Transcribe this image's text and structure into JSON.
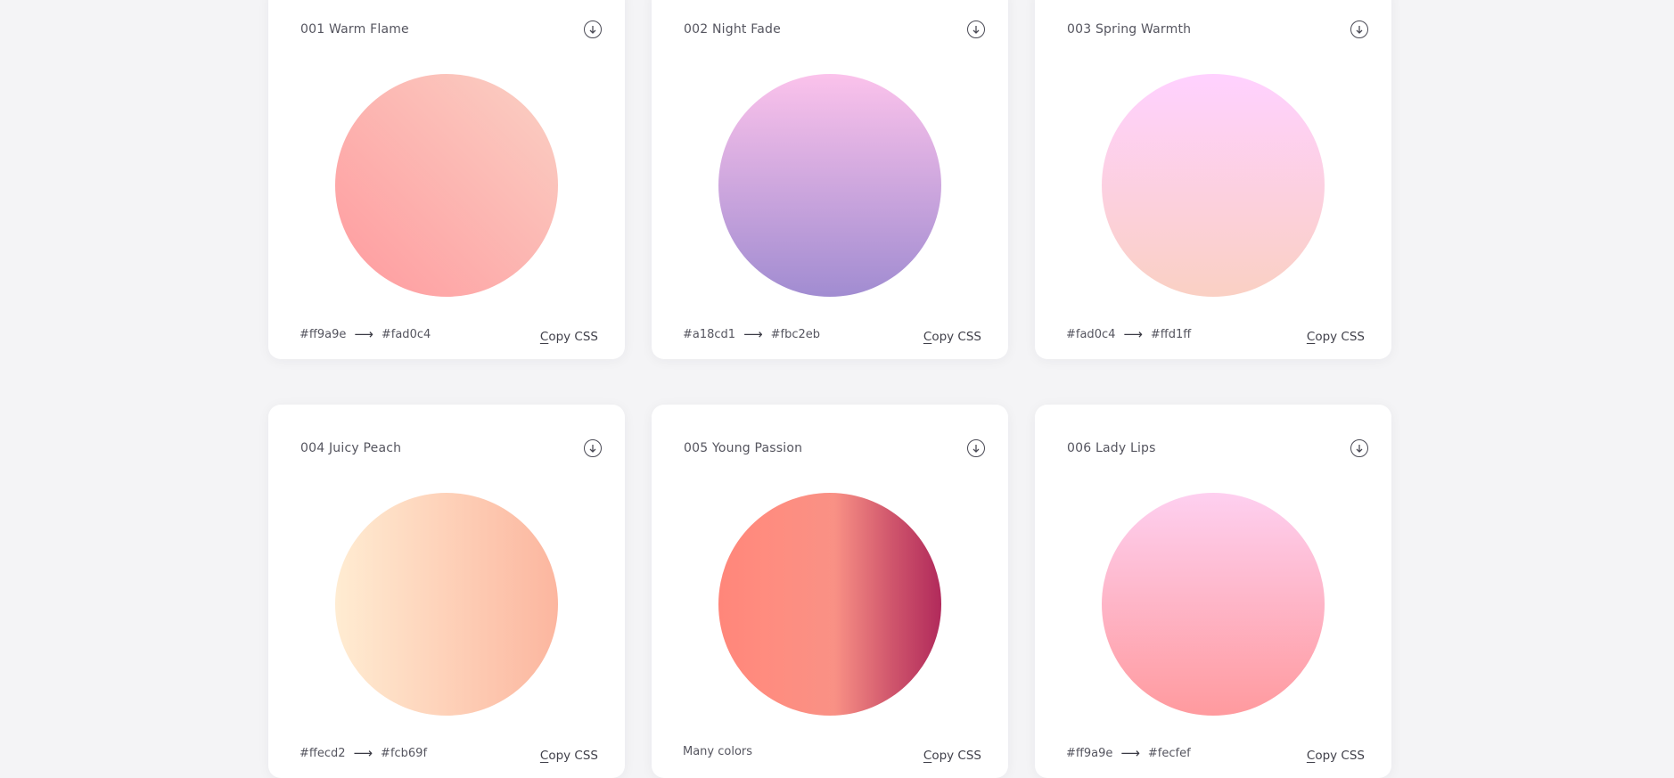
{
  "gradients": [
    {
      "title": "001 Warm Flame",
      "color_from": "#ff9a9e",
      "arrow": "⟶",
      "color_to": "#fad0c4",
      "colors_text": "",
      "copy_label": "Copy CSS",
      "css": "linear-gradient(45deg, #ff9a9e 0%, #fad0c4 99%, #fad0c4 100%)"
    },
    {
      "title": "002 Night Fade",
      "color_from": "#a18cd1",
      "arrow": "⟶",
      "color_to": "#fbc2eb",
      "colors_text": "",
      "copy_label": "Copy CSS",
      "css": "linear-gradient(to top, #a18cd1 0%, #fbc2eb 100%)"
    },
    {
      "title": "003 Spring Warmth",
      "color_from": "#fad0c4",
      "arrow": "⟶",
      "color_to": "#ffd1ff",
      "colors_text": "",
      "copy_label": "Copy CSS",
      "css": "linear-gradient(to top, #fad0c4 0%, #fad0c4 1%, #ffd1ff 100%)"
    },
    {
      "title": "004 Juicy Peach",
      "color_from": "#ffecd2",
      "arrow": "⟶",
      "color_to": "#fcb69f",
      "colors_text": "",
      "copy_label": "Copy CSS",
      "css": "linear-gradient(to right, #ffecd2 0%, #fcb69f 100%)"
    },
    {
      "title": "005 Young Passion",
      "color_from": "",
      "arrow": "",
      "color_to": "",
      "colors_text": "Many colors",
      "copy_label": "Copy CSS",
      "css": "linear-gradient(to right, #ff8177 0%, #ff867a 0%, #ff8c7f 21%, #f99185 52%, #cf556c 78%, #b12a5b 100%)"
    },
    {
      "title": "006 Lady Lips",
      "color_from": "#ff9a9e",
      "arrow": "⟶",
      "color_to": "#fecfef",
      "colors_text": "",
      "copy_label": "Copy CSS",
      "css": "linear-gradient(to top, #ff9a9e 0%, #fecfef 99%, #fecfef 100%)"
    }
  ]
}
